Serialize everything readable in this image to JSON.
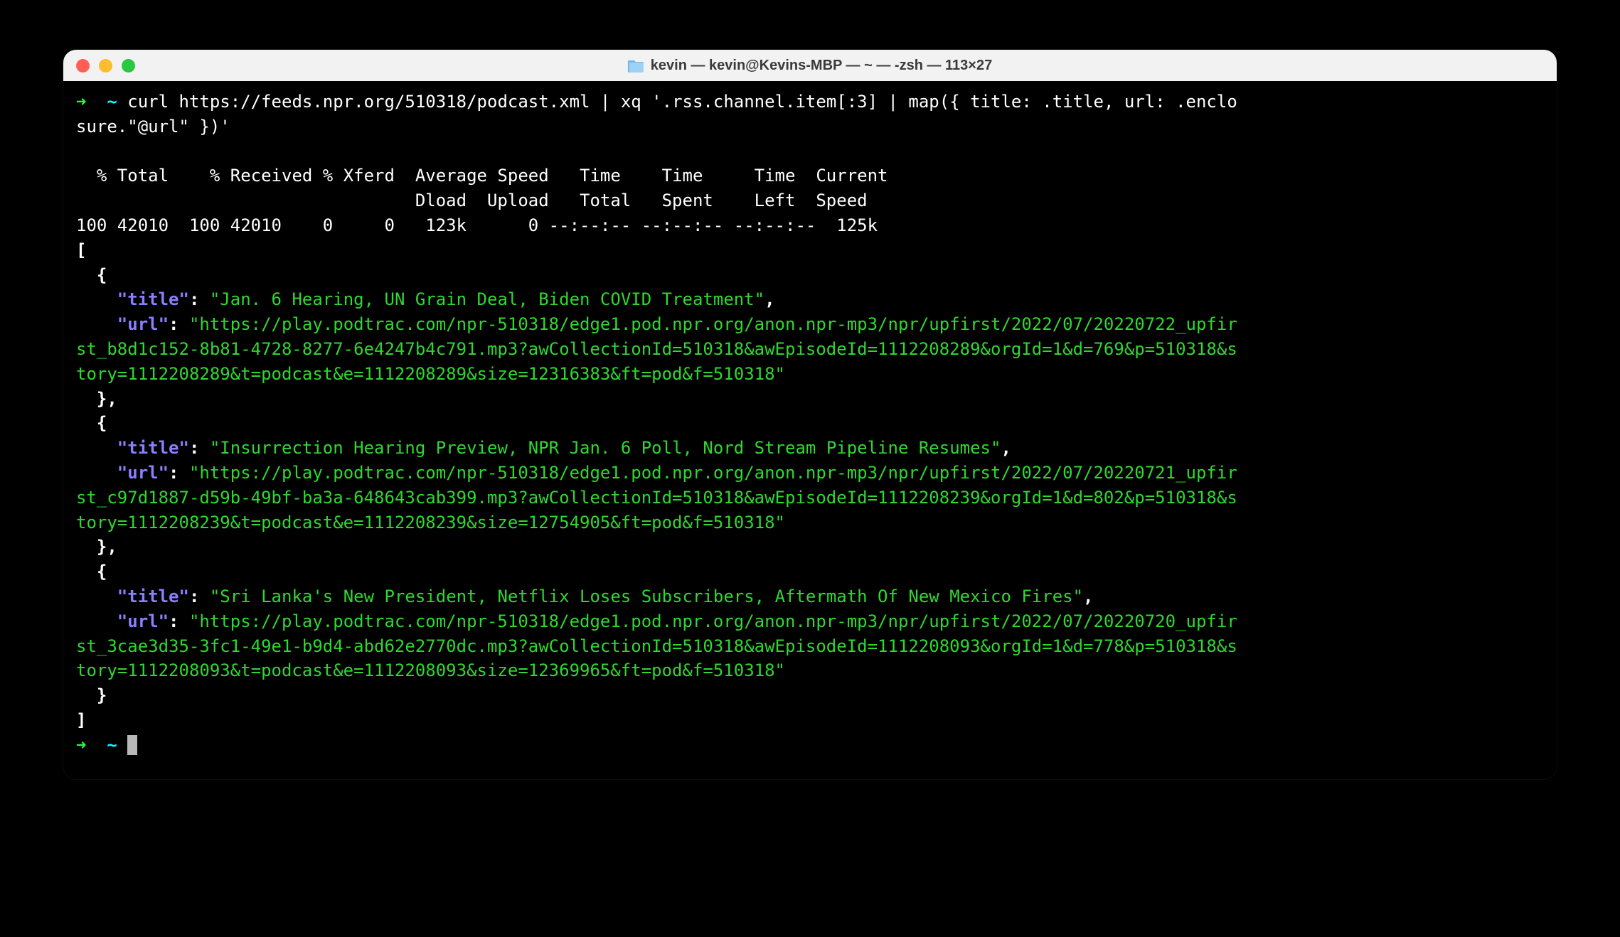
{
  "window": {
    "title": "kevin — kevin@Kevins-MBP — ~ — -zsh — 113×27"
  },
  "prompt": {
    "arrow": "➜",
    "tilde": "~"
  },
  "command": {
    "line1": "curl https://feeds.npr.org/510318/podcast.xml | xq '.rss.channel.item[:3] | map({ title: .title, url: .enclo",
    "line2": "sure.\"@url\" })'"
  },
  "curl_progress": {
    "header1": "  % Total    % Received % Xferd  Average Speed   Time    Time     Time  Current",
    "header2": "                                 Dload  Upload   Total   Spent    Left  Speed",
    "row": "100 42010  100 42010    0     0   123k      0 --:--:-- --:--:-- --:--:--  125k"
  },
  "json_output": {
    "open_bracket": "[",
    "close_bracket": "]",
    "items": [
      {
        "title_key": "\"title\"",
        "title_val": "\"Jan. 6 Hearing, UN Grain Deal, Biden COVID Treatment\"",
        "url_key": "\"url\"",
        "url_line1": "\"https://play.podtrac.com/npr-510318/edge1.pod.npr.org/anon.npr-mp3/npr/upfirst/2022/07/20220722_upfir",
        "url_line2": "st_b8d1c152-8b81-4728-8277-6e4247b4c791.mp3?awCollectionId=510318&awEpisodeId=1112208289&orgId=1&d=769&p=510318&s",
        "url_line3": "tory=1112208289&t=podcast&e=1112208289&size=12316383&ft=pod&f=510318\""
      },
      {
        "title_key": "\"title\"",
        "title_val": "\"Insurrection Hearing Preview, NPR Jan. 6 Poll, Nord Stream Pipeline Resumes\"",
        "url_key": "\"url\"",
        "url_line1": "\"https://play.podtrac.com/npr-510318/edge1.pod.npr.org/anon.npr-mp3/npr/upfirst/2022/07/20220721_upfir",
        "url_line2": "st_c97d1887-d59b-49bf-ba3a-648643cab399.mp3?awCollectionId=510318&awEpisodeId=1112208239&orgId=1&d=802&p=510318&s",
        "url_line3": "tory=1112208239&t=podcast&e=1112208239&size=12754905&ft=pod&f=510318\""
      },
      {
        "title_key": "\"title\"",
        "title_val": "\"Sri Lanka's New President, Netflix Loses Subscribers, Aftermath Of New Mexico Fires\"",
        "url_key": "\"url\"",
        "url_line1": "\"https://play.podtrac.com/npr-510318/edge1.pod.npr.org/anon.npr-mp3/npr/upfirst/2022/07/20220720_upfir",
        "url_line2": "st_3cae3d35-3fc1-49e1-b9d4-abd62e2770dc.mp3?awCollectionId=510318&awEpisodeId=1112208093&orgId=1&d=778&p=510318&s",
        "url_line3": "tory=1112208093&t=podcast&e=1112208093&size=12369965&ft=pod&f=510318\""
      }
    ]
  }
}
